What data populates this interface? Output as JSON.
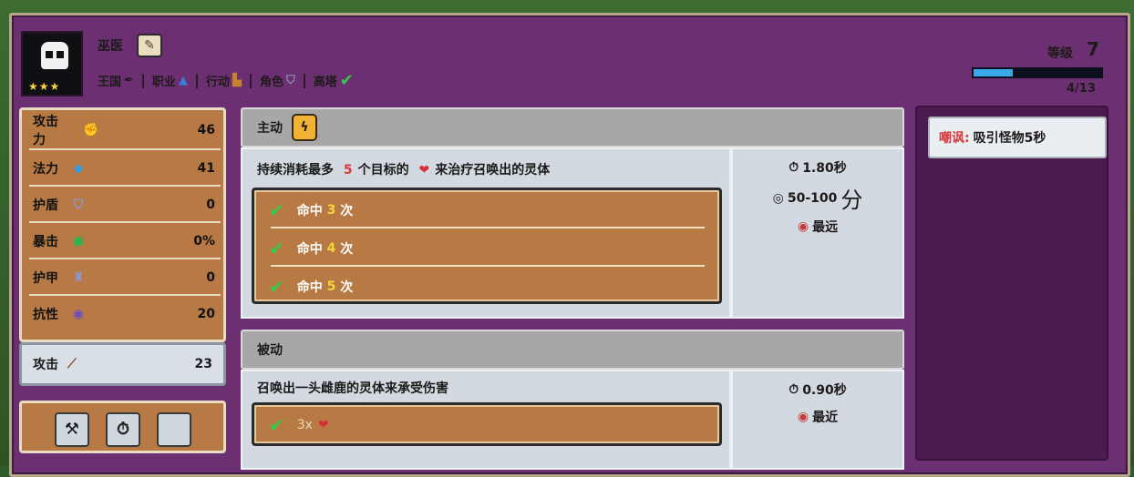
{
  "hero": {
    "name": "巫医",
    "stars": "★★★",
    "traits": [
      {
        "label": "王国",
        "icon": "feather-icon"
      },
      {
        "label": "职业",
        "icon": "wizard-hat-icon"
      },
      {
        "label": "行动",
        "icon": "boot-icon"
      },
      {
        "label": "角色",
        "icon": "shield-icon"
      },
      {
        "label": "高塔",
        "icon": "check-icon"
      }
    ],
    "level_label": "等级",
    "level": "7",
    "xp_text": "4/13",
    "xp_fraction": 0.31
  },
  "stats": [
    {
      "label": "攻击力",
      "value": "46",
      "icon": "fist-icon"
    },
    {
      "label": "法力",
      "value": "41",
      "icon": "mana-icon"
    },
    {
      "label": "护盾",
      "value": "0",
      "icon": "shield-icon"
    },
    {
      "label": "暴击",
      "value": "0%",
      "icon": "crit-icon"
    },
    {
      "label": "护甲",
      "value": "0",
      "icon": "armor-icon"
    },
    {
      "label": "抗性",
      "value": "20",
      "icon": "resist-icon"
    }
  ],
  "attack": {
    "label": "攻击",
    "value": "23"
  },
  "active": {
    "header": "主动",
    "desc_pre": "持续消耗最多",
    "desc_num": "5",
    "desc_mid": "个目标的",
    "desc_post": "来治疗召唤出的灵体",
    "hits": [
      {
        "pre": "命中",
        "num": "3",
        "post": "次"
      },
      {
        "pre": "命中",
        "num": "4",
        "post": "次"
      },
      {
        "pre": "命中",
        "num": "5",
        "post": "次"
      }
    ],
    "cooldown": "1.80秒",
    "range": "50-100",
    "range_unit": "分",
    "target": "最远"
  },
  "passive": {
    "header": "被动",
    "desc": "召唤出一头雌鹿的灵体来承受伤害",
    "hit": "3x",
    "cooldown": "0.90秒",
    "target": "最近"
  },
  "taunt": {
    "label": "嘲讽:",
    "text": "吸引怪物5秒"
  }
}
